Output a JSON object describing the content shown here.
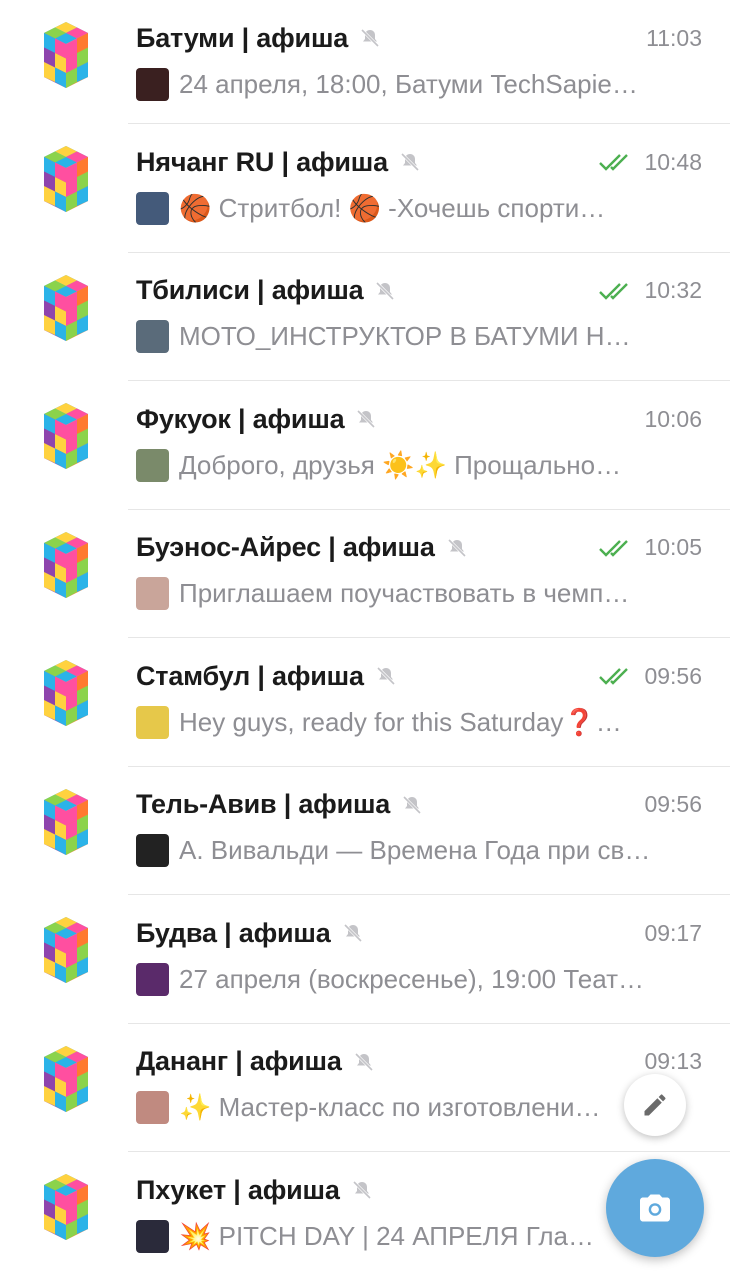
{
  "chats": [
    {
      "title": "Батуми | афиша",
      "time": "11:03",
      "read": false,
      "thumb": "#3a2020",
      "preview": "24 апреля, 18:00, Батуми TechSapie…"
    },
    {
      "title": "Нячанг RU | афиша",
      "time": "10:48",
      "read": true,
      "thumb": "#445a7a",
      "preview": "🏀 Стритбол! 🏀    ‑Хочешь спорти…"
    },
    {
      "title": "Тбилиси | афиша",
      "time": "10:32",
      "read": true,
      "thumb": "#5a6b7a",
      "preview": "МОТО_ИНСТРУКТОР В БАТУМИ   Н…"
    },
    {
      "title": "Фукуок | афиша",
      "time": "10:06",
      "read": false,
      "thumb": "#7a8a6a",
      "preview": "Доброго, друзья ☀️✨  Прощально…"
    },
    {
      "title": "Буэнос-Айрес | афиша",
      "time": "10:05",
      "read": true,
      "thumb": "#c9a59a",
      "preview": "Приглашаем поучаствовать в чемп…"
    },
    {
      "title": "Стамбул | афиша",
      "time": "09:56",
      "read": true,
      "thumb": "#e6c84a",
      "preview": "Hey guys, ready for this Saturday❓…"
    },
    {
      "title": "Тель-Авив | афиша",
      "time": "09:56",
      "read": false,
      "thumb": "#222222",
      "preview": "А. Вивальди — Времена Года при св…"
    },
    {
      "title": "Будва | афиша",
      "time": "09:17",
      "read": false,
      "thumb": "#5a2a6a",
      "preview": "27 апреля (воскресенье), 19:00 Теат…"
    },
    {
      "title": "Дананг | афиша",
      "time": "09:13",
      "read": false,
      "thumb": "#c08a80",
      "preview": "✨ Мастер-класс по изготовлени…"
    },
    {
      "title": "Пхукет | афиша",
      "time": "",
      "read": true,
      "thumb": "#2a2a3a",
      "preview": "💥 PITCH DAY | 24 АПРЕЛЯ    Гла…"
    }
  ],
  "icons": {
    "mute": "muted-bell-icon",
    "read": "double-check-icon",
    "edit": "pencil-icon",
    "camera": "camera-icon"
  },
  "colors": {
    "read_check": "#4caf50",
    "time": "#8e8e93",
    "camera_fab": "#5fa9dd"
  }
}
